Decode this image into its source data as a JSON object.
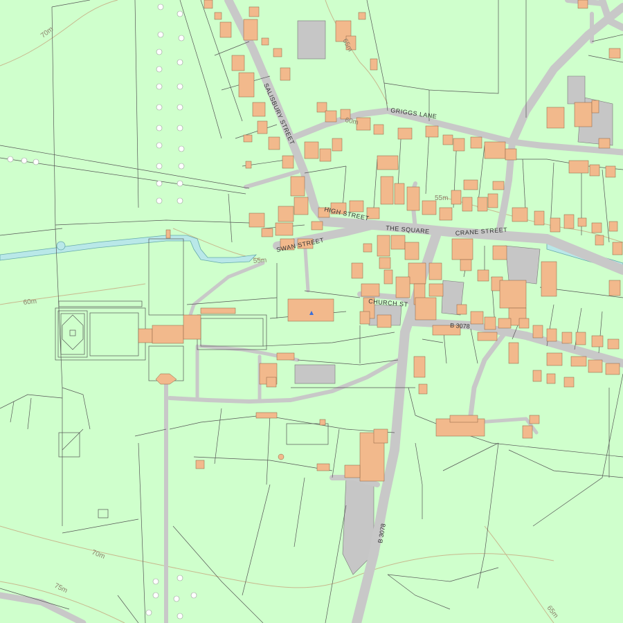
{
  "map": {
    "colors": {
      "land": "#cfffcc",
      "building": "#f2b98c",
      "road": "#c8c8c8",
      "paved": "#c6c6c6",
      "water": "#b9e8e8",
      "line": "#555555",
      "contour": "#c8b88e",
      "tree": "#ffffff"
    },
    "street_names": {
      "salisbury": "SALISBURY STREET",
      "griggs": "GRIGGS LANE",
      "high": "HIGH STREET",
      "square": "THE SQUARE",
      "crane": "CRANE STREET",
      "swan": "SWAN STREET",
      "church": "CHURCH ST"
    },
    "road_codes": {
      "b3078_east": "B 3078",
      "b3078_south": "B 3078"
    },
    "contour_labels": {
      "c70_nw": "70m",
      "c65_n": "65m",
      "c60_center": "60m",
      "c55_east": "55m",
      "c55_south": "55m",
      "c60_west": "60m",
      "c70_sw": "70m",
      "c75_sw": "75m",
      "c65_se": "65m"
    },
    "icons": [
      "church-cross-icon"
    ]
  }
}
